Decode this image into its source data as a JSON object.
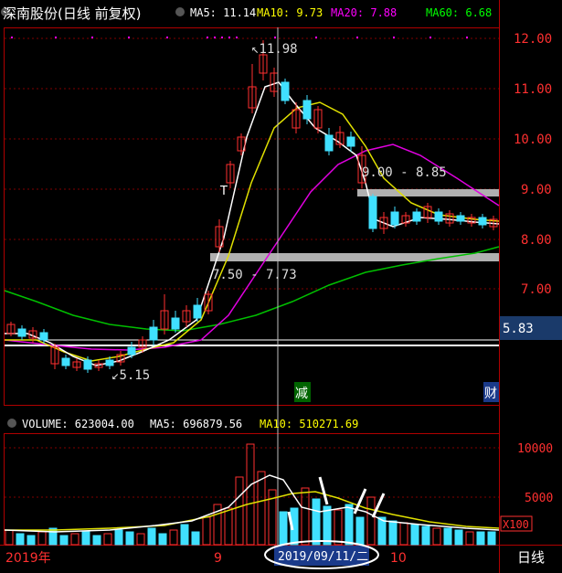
{
  "header": {
    "title": "深南股份(日线 前复权)",
    "ma": [
      {
        "label": "MA5: 11.14",
        "color": "#ffffff"
      },
      {
        "label": "MA10: 9.73",
        "color": "#ffff00"
      },
      {
        "label": "MA20: 7.88",
        "color": "#ff00ff"
      },
      {
        "label": "MA60: 6.68",
        "color": "#00ff00"
      }
    ]
  },
  "price_axis": {
    "ticks": [
      "12.00",
      "11.00",
      "10.00",
      "9.00",
      "8.00",
      "7.00"
    ],
    "current_tag": "5.83"
  },
  "annotations": {
    "high": "11.98",
    "low": "5.15",
    "zone_upper": "9.00 - 8.85",
    "zone_lower": "7.50 - 7.73",
    "t_marker": "T",
    "badge_left": "减",
    "badge_right": "财"
  },
  "volume": {
    "header": [
      {
        "label": "VOLUME: 623004.00",
        "color": "#ffffff"
      },
      {
        "label": "MA5: 696879.56",
        "color": "#ffffff"
      },
      {
        "label": "MA10: 510271.69",
        "color": "#ffff00"
      }
    ],
    "ticks": [
      "10000",
      "5000"
    ],
    "unit": "X100"
  },
  "date_axis": {
    "labels": [
      "2019年",
      "9",
      "10"
    ],
    "cursor_date": "2019/09/11/二",
    "period": "日线"
  }
}
